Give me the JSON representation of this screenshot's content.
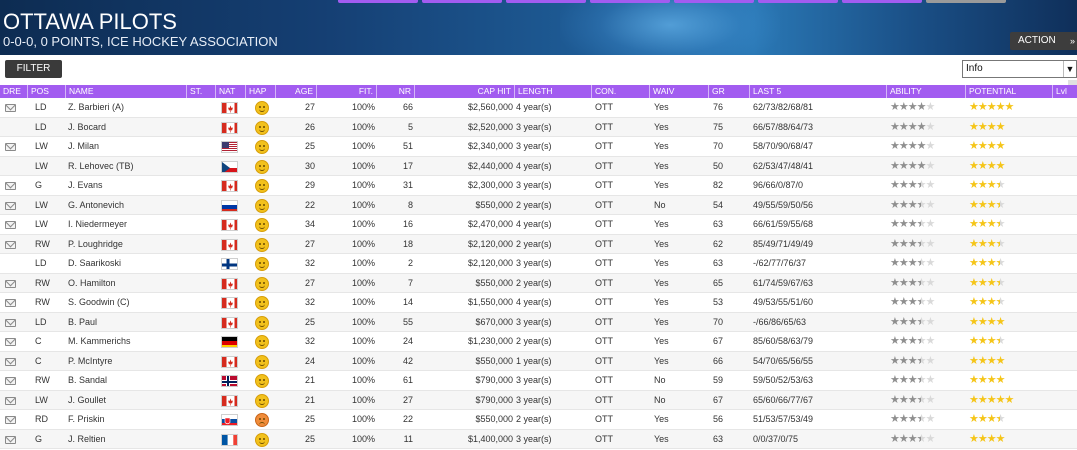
{
  "header": {
    "title": "OTTAWA PILOTS",
    "subtitle": "0-0-0, 0 POINTS, ICE HOCKEY ASSOCIATION",
    "action_label": "ACTION",
    "action_chevron": "»"
  },
  "toolbar": {
    "filter_label": "FILTER",
    "view_select_value": "Info"
  },
  "colors": {
    "accent": "#a25cf0",
    "header_dark": "#0d2c52",
    "star_gold": "#f5c518",
    "star_grey": "#8f8f8f"
  },
  "columns": [
    "DRE",
    "POS",
    "NAME",
    "ST.",
    "NAT",
    "HAP",
    "AGE",
    "FIT.",
    "NR",
    "CAP HIT",
    "LENGTH",
    "CON.",
    "WAIV",
    "GR",
    "LAST 5",
    "ABILITY",
    "POTENTIAL",
    "Lvl"
  ],
  "players": [
    {
      "dre": true,
      "pos": "LD",
      "name": "Z. Barbieri (A)",
      "nat": "CAN",
      "hap": "happy",
      "age": "27",
      "fit": "100%",
      "nr": "66",
      "cap": "$2,560,000",
      "len": "4 year(s)",
      "con": "OTT",
      "waiv": "Yes",
      "gr": "76",
      "last5": "62/73/82/68/81",
      "ability": 4,
      "potential": 5
    },
    {
      "dre": false,
      "pos": "LD",
      "name": "J. Bocard",
      "nat": "CAN",
      "hap": "happy",
      "age": "26",
      "fit": "100%",
      "nr": "5",
      "cap": "$2,520,000",
      "len": "3 year(s)",
      "con": "OTT",
      "waiv": "Yes",
      "gr": "75",
      "last5": "66/57/88/64/73",
      "ability": 4,
      "potential": 4
    },
    {
      "dre": true,
      "pos": "LW",
      "name": "J. Milan",
      "nat": "USA",
      "hap": "happy",
      "age": "25",
      "fit": "100%",
      "nr": "51",
      "cap": "$2,340,000",
      "len": "3 year(s)",
      "con": "OTT",
      "waiv": "Yes",
      "gr": "70",
      "last5": "58/70/90/68/47",
      "ability": 4,
      "potential": 4
    },
    {
      "dre": false,
      "pos": "LW",
      "name": "R. Lehovec (TB)",
      "nat": "CZE",
      "hap": "happy",
      "age": "30",
      "fit": "100%",
      "nr": "17",
      "cap": "$2,440,000",
      "len": "4 year(s)",
      "con": "OTT",
      "waiv": "Yes",
      "gr": "50",
      "last5": "62/53/47/48/41",
      "ability": 4,
      "potential": 4
    },
    {
      "dre": true,
      "pos": "G",
      "name": "J. Evans",
      "nat": "CAN",
      "hap": "happy",
      "age": "29",
      "fit": "100%",
      "nr": "31",
      "cap": "$2,300,000",
      "len": "3 year(s)",
      "con": "OTT",
      "waiv": "Yes",
      "gr": "82",
      "last5": "96/66/0/87/0",
      "ability": 3.5,
      "potential": 3.5
    },
    {
      "dre": true,
      "pos": "LW",
      "name": "G. Antonevich",
      "nat": "RUS",
      "hap": "happy",
      "age": "22",
      "fit": "100%",
      "nr": "8",
      "cap": "$550,000",
      "len": "2 year(s)",
      "con": "OTT",
      "waiv": "No",
      "gr": "54",
      "last5": "49/55/59/50/56",
      "ability": 3.5,
      "potential": 3.5
    },
    {
      "dre": true,
      "pos": "LW",
      "name": "I. Niedermeyer",
      "nat": "CAN",
      "hap": "happy",
      "age": "34",
      "fit": "100%",
      "nr": "16",
      "cap": "$2,470,000",
      "len": "4 year(s)",
      "con": "OTT",
      "waiv": "Yes",
      "gr": "63",
      "last5": "66/61/59/55/68",
      "ability": 3.5,
      "potential": 3.5
    },
    {
      "dre": true,
      "pos": "RW",
      "name": "P. Loughridge",
      "nat": "CAN",
      "hap": "happy",
      "age": "27",
      "fit": "100%",
      "nr": "18",
      "cap": "$2,120,000",
      "len": "2 year(s)",
      "con": "OTT",
      "waiv": "Yes",
      "gr": "62",
      "last5": "85/49/71/49/49",
      "ability": 3.5,
      "potential": 3.5
    },
    {
      "dre": false,
      "pos": "LD",
      "name": "D. Saarikoski",
      "nat": "FIN",
      "hap": "happy",
      "age": "32",
      "fit": "100%",
      "nr": "2",
      "cap": "$2,120,000",
      "len": "3 year(s)",
      "con": "OTT",
      "waiv": "Yes",
      "gr": "63",
      "last5": "-/62/77/76/37",
      "ability": 3.5,
      "potential": 3.5
    },
    {
      "dre": true,
      "pos": "RW",
      "name": "O. Hamilton",
      "nat": "CAN",
      "hap": "happy",
      "age": "27",
      "fit": "100%",
      "nr": "7",
      "cap": "$550,000",
      "len": "2 year(s)",
      "con": "OTT",
      "waiv": "Yes",
      "gr": "65",
      "last5": "61/74/59/67/63",
      "ability": 3.5,
      "potential": 3.5
    },
    {
      "dre": true,
      "pos": "RW",
      "name": "S. Goodwin (C)",
      "nat": "CAN",
      "hap": "happy",
      "age": "32",
      "fit": "100%",
      "nr": "14",
      "cap": "$1,550,000",
      "len": "4 year(s)",
      "con": "OTT",
      "waiv": "Yes",
      "gr": "53",
      "last5": "49/53/55/51/60",
      "ability": 3.5,
      "potential": 3.5
    },
    {
      "dre": true,
      "pos": "LD",
      "name": "B. Paul",
      "nat": "CAN",
      "hap": "happy",
      "age": "25",
      "fit": "100%",
      "nr": "55",
      "cap": "$670,000",
      "len": "3 year(s)",
      "con": "OTT",
      "waiv": "Yes",
      "gr": "70",
      "last5": "-/66/86/65/63",
      "ability": 3.5,
      "potential": 4
    },
    {
      "dre": true,
      "pos": "C",
      "name": "M. Kammerichs",
      "nat": "GER",
      "hap": "happy",
      "age": "32",
      "fit": "100%",
      "nr": "24",
      "cap": "$1,230,000",
      "len": "2 year(s)",
      "con": "OTT",
      "waiv": "Yes",
      "gr": "67",
      "last5": "85/60/58/63/79",
      "ability": 3.5,
      "potential": 3.5
    },
    {
      "dre": true,
      "pos": "C",
      "name": "P. McIntyre",
      "nat": "CAN",
      "hap": "happy",
      "age": "24",
      "fit": "100%",
      "nr": "42",
      "cap": "$550,000",
      "len": "1 year(s)",
      "con": "OTT",
      "waiv": "Yes",
      "gr": "66",
      "last5": "54/70/65/56/55",
      "ability": 3.5,
      "potential": 4
    },
    {
      "dre": true,
      "pos": "RW",
      "name": "B. Sandal",
      "nat": "NOR",
      "hap": "happy",
      "age": "21",
      "fit": "100%",
      "nr": "61",
      "cap": "$790,000",
      "len": "3 year(s)",
      "con": "OTT",
      "waiv": "No",
      "gr": "59",
      "last5": "59/50/52/53/63",
      "ability": 3.5,
      "potential": 4
    },
    {
      "dre": true,
      "pos": "LW",
      "name": "J. Goullet",
      "nat": "CAN",
      "hap": "happy",
      "age": "21",
      "fit": "100%",
      "nr": "27",
      "cap": "$790,000",
      "len": "3 year(s)",
      "con": "OTT",
      "waiv": "No",
      "gr": "67",
      "last5": "65/60/66/77/67",
      "ability": 3.5,
      "potential": 5
    },
    {
      "dre": true,
      "pos": "RD",
      "name": "F. Priskin",
      "nat": "SVK",
      "hap": "sad",
      "age": "25",
      "fit": "100%",
      "nr": "22",
      "cap": "$550,000",
      "len": "2 year(s)",
      "con": "OTT",
      "waiv": "Yes",
      "gr": "56",
      "last5": "51/53/57/53/49",
      "ability": 3.5,
      "potential": 3.5
    },
    {
      "dre": true,
      "pos": "G",
      "name": "J. Reltien",
      "nat": "FRA",
      "hap": "happy",
      "age": "25",
      "fit": "100%",
      "nr": "11",
      "cap": "$1,400,000",
      "len": "3 year(s)",
      "con": "OTT",
      "waiv": "Yes",
      "gr": "63",
      "last5": "0/0/37/0/75",
      "ability": 3.5,
      "potential": 4
    }
  ]
}
